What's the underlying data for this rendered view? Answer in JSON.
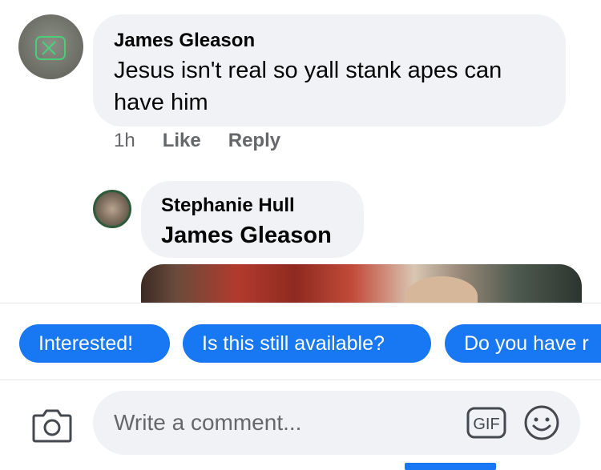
{
  "comments": [
    {
      "author": "James Gleason",
      "text": "Jesus isn't real so yall stank apes can have him",
      "time": "1h",
      "like_label": "Like",
      "reply_label": "Reply"
    },
    {
      "author": "Stephanie Hull",
      "mention": "James Gleason"
    }
  ],
  "quick_replies": [
    "Interested!",
    "Is this still available?",
    "Do you have r"
  ],
  "composer": {
    "placeholder": "Write a comment...",
    "camera_icon": "camera-icon",
    "gif_icon": "gif-icon",
    "gif_label": "GIF",
    "emoji_icon": "smiley-icon"
  },
  "colors": {
    "accent": "#1877f2",
    "bubble": "#f0f2f5",
    "secondary_text": "#65676b"
  }
}
